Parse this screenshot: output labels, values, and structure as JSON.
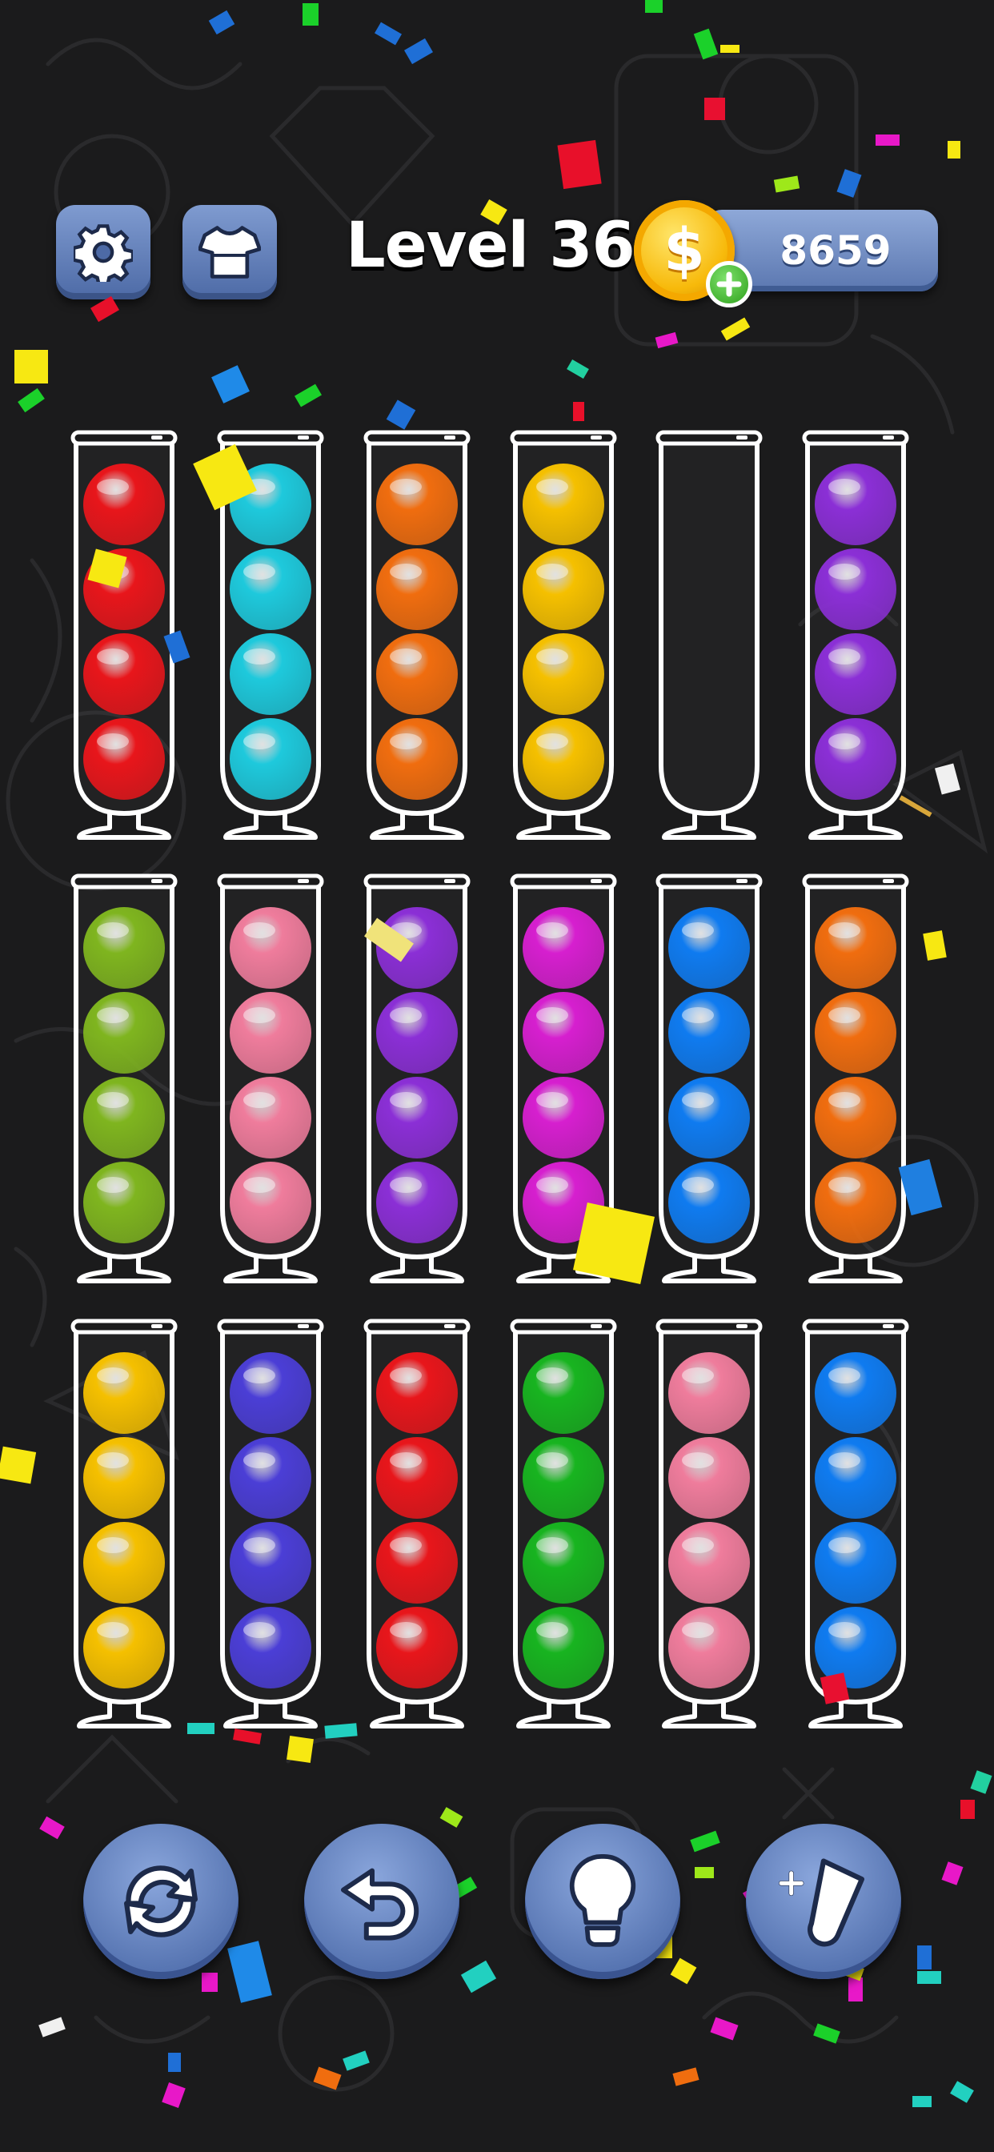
{
  "header": {
    "level_label": "Level 36",
    "coins": "8659",
    "coin_symbol": "$",
    "settings_icon": "gear-icon",
    "shop_icon": "shirt-icon",
    "add_coins_icon": "plus-icon"
  },
  "board": {
    "tube_capacity": 4,
    "rows": [
      [
        [
          "red",
          "red",
          "red",
          "red"
        ],
        [
          "cyan",
          "cyan",
          "cyan",
          "cyan"
        ],
        [
          "orange",
          "orange",
          "orange",
          "orange"
        ],
        [
          "yellow",
          "yellow",
          "yellow",
          "yellow"
        ],
        [],
        [
          "purple",
          "purple",
          "purple",
          "purple"
        ]
      ],
      [
        [
          "lime",
          "lime",
          "lime",
          "lime"
        ],
        [
          "pink",
          "pink",
          "pink",
          "pink"
        ],
        [
          "purple",
          "purple",
          "purple",
          "purple"
        ],
        [
          "magenta",
          "magenta",
          "magenta",
          "magenta"
        ],
        [
          "blue",
          "blue",
          "blue",
          "blue"
        ],
        [
          "orange",
          "orange",
          "orange",
          "orange"
        ]
      ],
      [
        [
          "yellow",
          "yellow",
          "yellow",
          "yellow"
        ],
        [
          "indigo",
          "indigo",
          "indigo",
          "indigo"
        ],
        [
          "red",
          "red",
          "red",
          "red"
        ],
        [
          "green",
          "green",
          "green",
          "green"
        ],
        [
          "pink",
          "pink",
          "pink",
          "pink"
        ],
        [
          "blue",
          "blue",
          "blue",
          "blue"
        ]
      ]
    ]
  },
  "ball_colors": {
    "red": "#e8161b",
    "cyan": "#1ec9dc",
    "orange": "#f06d0f",
    "yellow": "#f5c000",
    "purple": "#8b2fd6",
    "lime": "#7fb51f",
    "pink": "#ef7c9c",
    "magenta": "#d61fcf",
    "blue": "#0f7bf0",
    "indigo": "#4b3ed6",
    "green": "#18b420"
  },
  "controls": [
    {
      "name": "restart-button",
      "icon": "restart-icon"
    },
    {
      "name": "undo-button",
      "icon": "undo-icon"
    },
    {
      "name": "hint-button",
      "icon": "lightbulb-icon"
    },
    {
      "name": "add-tube-button",
      "icon": "add-tube-icon"
    }
  ]
}
